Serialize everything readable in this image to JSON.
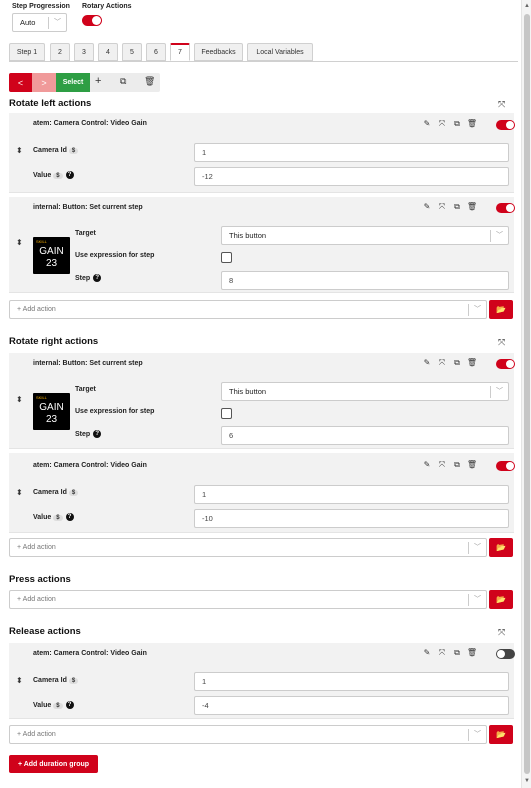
{
  "header": {
    "step_progression_label": "Step Progression",
    "step_progression_value": "Auto",
    "rotary_label": "Rotary Actions",
    "rotary_enabled": true
  },
  "tabs": [
    "Step 1",
    "2",
    "3",
    "4",
    "5",
    "6",
    "7",
    "Feedbacks",
    "Local Variables"
  ],
  "active_tab": "7",
  "toolbar": {
    "prev": "<",
    "next": ">",
    "select": "Select",
    "add": "+"
  },
  "sections": {
    "rotate_left": {
      "title": "Rotate left actions",
      "actions": [
        {
          "name": "atem: Camera Control: Video Gain",
          "camera_id_label": "Camera Id",
          "camera_id": "1",
          "value_label": "Value",
          "value": "-12",
          "badge": "$"
        },
        {
          "name": "internal: Button: Set current step",
          "target_label": "Target",
          "target": "This button",
          "expr_label": "Use expression for step",
          "step_label": "Step",
          "step": "8"
        }
      ],
      "add_action": "+ Add action"
    },
    "rotate_right": {
      "title": "Rotate right actions",
      "actions": [
        {
          "name": "internal: Button: Set current step",
          "target_label": "Target",
          "target": "This button",
          "expr_label": "Use expression for step",
          "step_label": "Step",
          "step": "6"
        },
        {
          "name": "atem: Camera Control: Video Gain",
          "camera_id_label": "Camera Id",
          "camera_id": "1",
          "value_label": "Value",
          "value": "-10",
          "badge": "$"
        }
      ],
      "add_action": "+ Add action"
    },
    "press": {
      "title": "Press actions",
      "add_action": "+ Add action"
    },
    "release": {
      "title": "Release actions",
      "actions": [
        {
          "name": "atem: Camera Control: Video Gain",
          "camera_id_label": "Camera Id",
          "camera_id": "1",
          "value_label": "Value",
          "value": "-4",
          "badge": "$"
        }
      ],
      "add_action": "+ Add action"
    }
  },
  "gain_button": {
    "corner": "SKILL",
    "line1": "GAIN",
    "line2": "23"
  },
  "add_duration_group": "+ Add duration group",
  "colors": {
    "accent": "#d0021b",
    "select": "#2e9e44"
  }
}
